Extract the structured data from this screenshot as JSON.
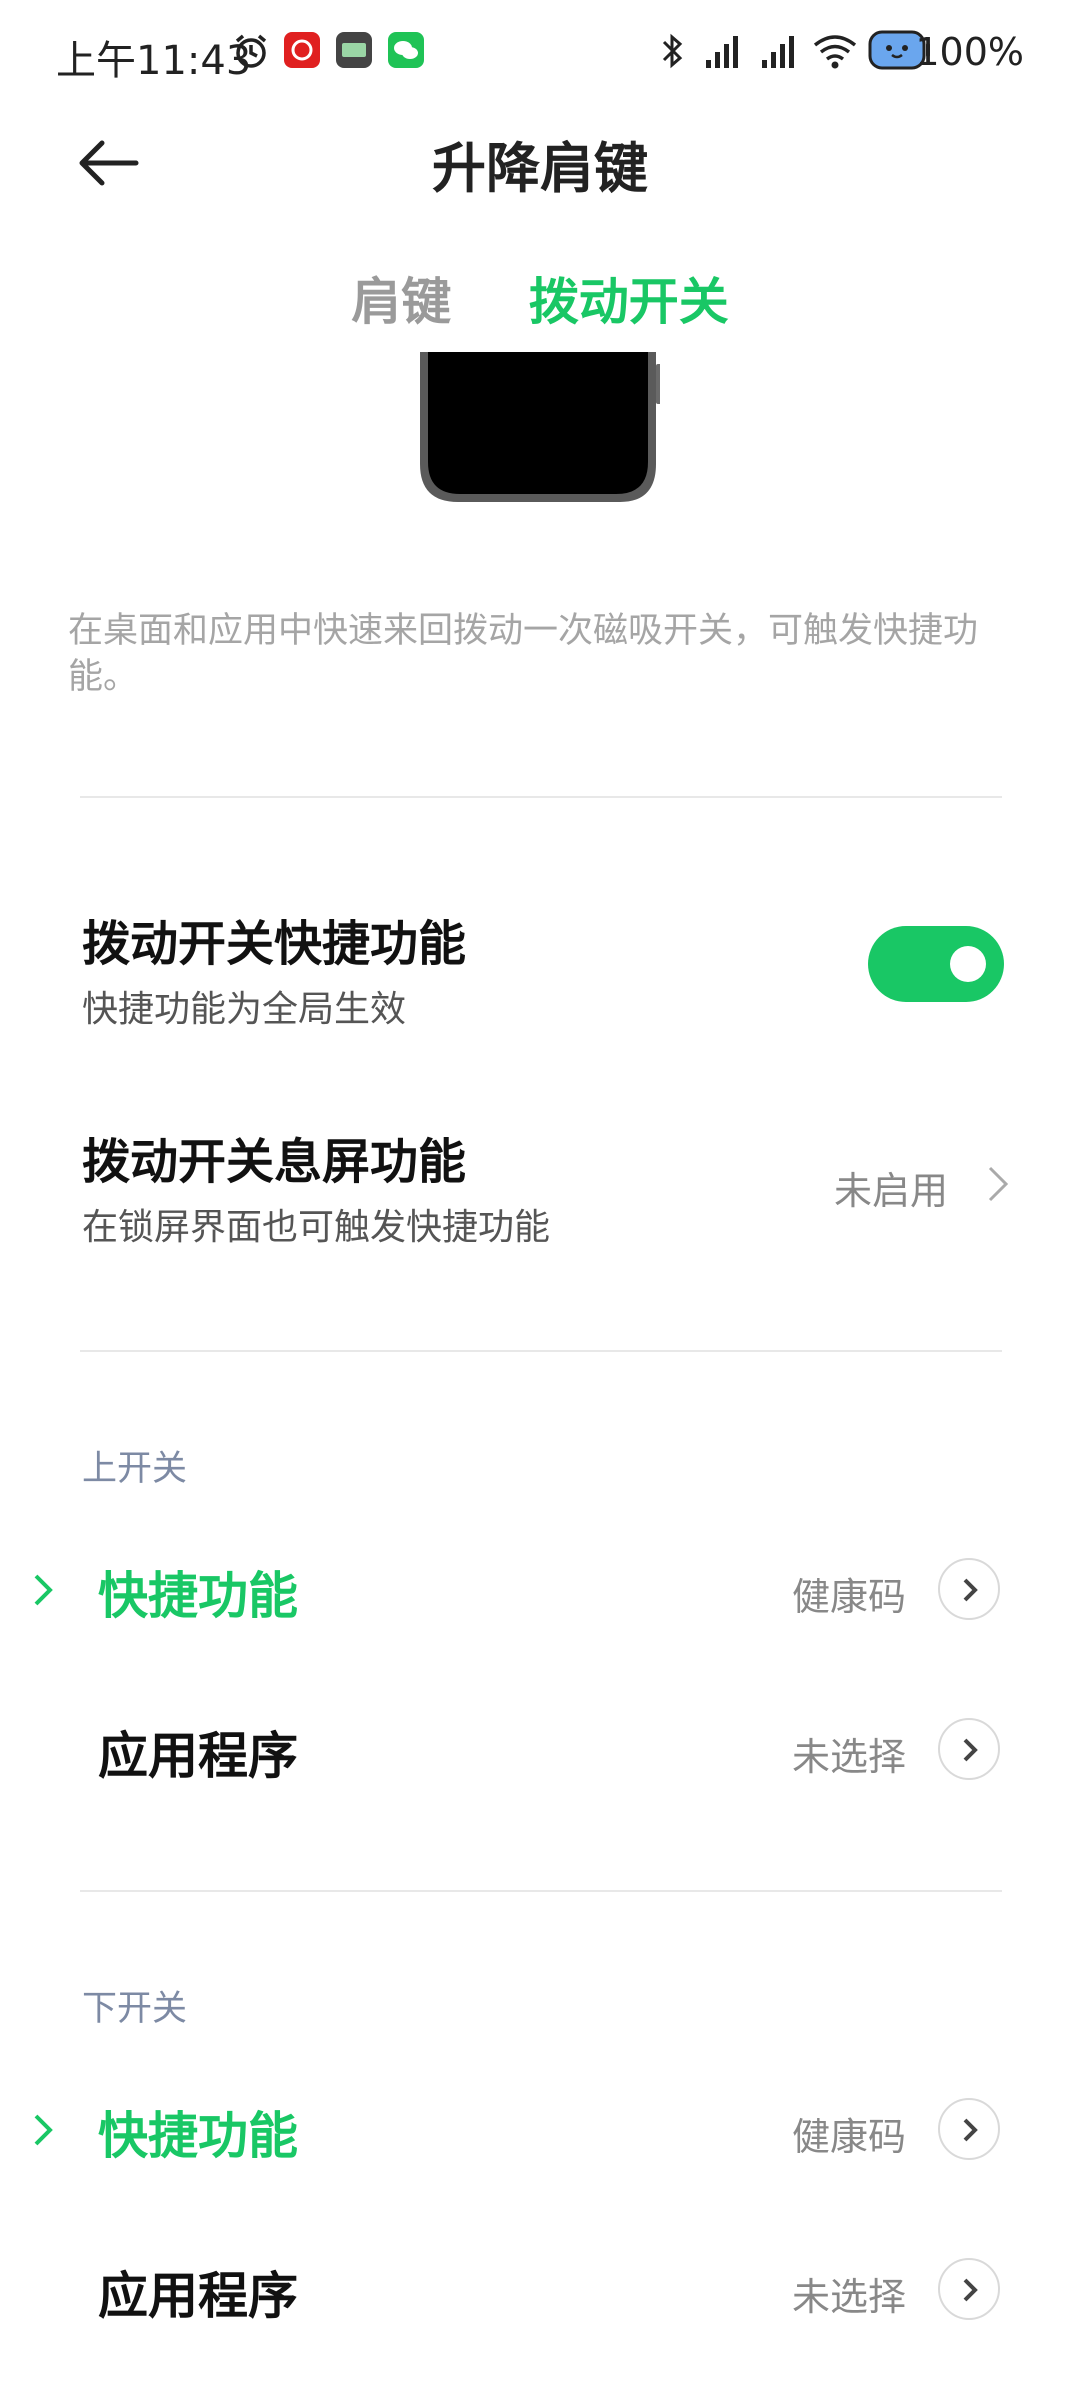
{
  "status_bar": {
    "time": "上午11:43",
    "battery": "100%"
  },
  "header": {
    "title": "升降肩键"
  },
  "tabs": [
    {
      "label": "肩键",
      "active": false
    },
    {
      "label": "拨动开关",
      "active": true
    }
  ],
  "description": "在桌面和应用中快速来回拨动一次磁吸开关，可触发快捷功能。",
  "settings": {
    "quick_function": {
      "title": "拨动开关快捷功能",
      "subtitle": "快捷功能为全局生效",
      "enabled": true
    },
    "screen_off": {
      "title": "拨动开关息屏功能",
      "subtitle": "在锁屏界面也可触发快捷功能",
      "value": "未启用"
    }
  },
  "upper_switch": {
    "header": "上开关",
    "quick": {
      "label": "快捷功能",
      "value": "健康码"
    },
    "app": {
      "label": "应用程序",
      "value": "未选择"
    }
  },
  "lower_switch": {
    "header": "下开关",
    "quick": {
      "label": "快捷功能",
      "value": "健康码"
    },
    "app": {
      "label": "应用程序",
      "value": "未选择"
    }
  },
  "colors": {
    "accent": "#19c765",
    "section_header": "#7d8aa4"
  }
}
